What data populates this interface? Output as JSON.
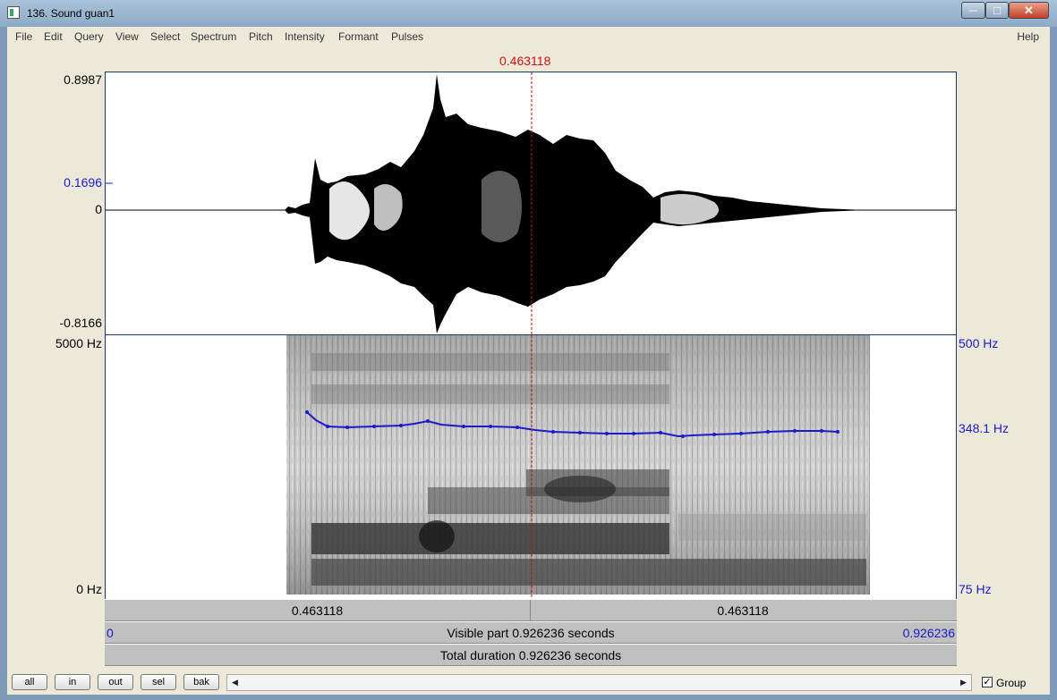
{
  "window": {
    "title": "136. Sound guan1"
  },
  "menu": [
    "File",
    "Edit",
    "Query",
    "View",
    "Select",
    "Spectrum",
    "Pitch",
    "Intensity",
    "Formant",
    "Pulses"
  ],
  "help": "Help",
  "cursor_time": "0.463118",
  "waveform": {
    "ymax": "0.8987",
    "ycursor": "0.1696",
    "yzero": "0",
    "ymin": "-0.8166"
  },
  "spectrogram": {
    "fmax": "5000 Hz",
    "fmin": "0 Hz"
  },
  "pitch": {
    "pmax": "500 Hz",
    "pcur": "348.1 Hz",
    "pmin": "75 Hz"
  },
  "time_bars": {
    "left_seg": "0.463118",
    "right_seg": "0.463118",
    "visible_start": "0",
    "visible_text": "Visible part 0.926236 seconds",
    "visible_end": "0.926236",
    "total_text": "Total duration 0.926236 seconds"
  },
  "buttons": [
    "all",
    "in",
    "out",
    "sel",
    "bak"
  ],
  "group_label": "Group",
  "group_checked": true
}
